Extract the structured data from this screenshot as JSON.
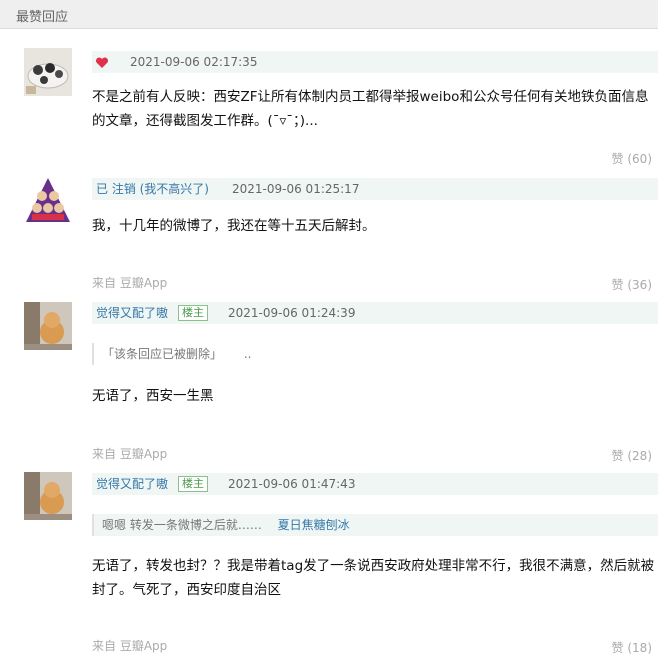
{
  "section": {
    "title": "最赞回应"
  },
  "comments": [
    {
      "author": "",
      "time": "2021-09-06 02:17:35",
      "text": "不是之前有人反映：西安ZF让所有体制内员工都得举报weibo和公众号任何有关地铁负面信息的文章，还得截图发工作群。(ˉ▿ˉ；)...",
      "source": "",
      "likes": "赞 (60)"
    },
    {
      "author": "已 注销 (我不高兴了)",
      "time": "2021-09-06 01:25:17",
      "text": "我，十几年的微博了，我还在等十五天后解封。",
      "source": "来自 豆瓣App",
      "likes": "赞 (36)"
    },
    {
      "author": "觉得又配了嗷",
      "badge": "楼主",
      "time": "2021-09-06 01:24:39",
      "quote": "「该条回应已被删除」",
      "quote_tail": "..",
      "text": "无语了，西安一生黑",
      "source": "来自 豆瓣App",
      "likes": "赞 (28)"
    },
    {
      "author": "觉得又配了嗷",
      "badge": "楼主",
      "time": "2021-09-06 01:47:43",
      "quote": "嗯嗯 转发一条微博之后就……",
      "quote_author": "夏日焦糖刨冰",
      "text": "无语了，转发也封？？我是带着tag发了一条说西安政府处理非常不行，我很不满意，然后就被封了。气死了，西安印度自治区",
      "source": "来自 豆瓣App",
      "likes": "赞 (18)"
    }
  ]
}
